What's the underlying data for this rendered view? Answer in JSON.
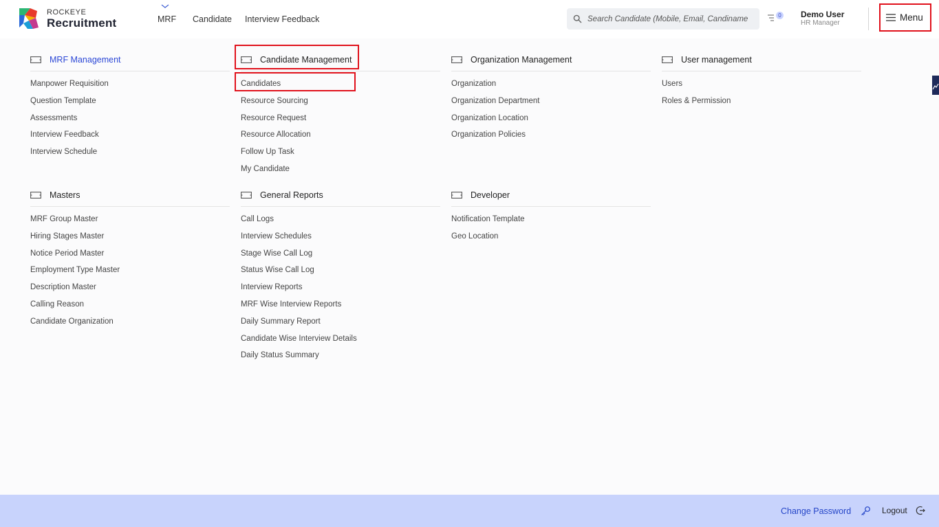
{
  "header": {
    "brand_top": "ROCKEYE",
    "brand_main": "Recruitment",
    "nav": [
      "MRF",
      "Candidate",
      "Interview Feedback"
    ],
    "search_placeholder": "Search Candidate (Mobile, Email, Candiname",
    "notification_count": "0",
    "user_name": "Demo User",
    "user_role": "HR Manager",
    "menu_label": "Menu"
  },
  "sections": [
    {
      "title": "MRF Management",
      "items": [
        "Manpower Requisition",
        "Question Template",
        "Assessments",
        "Interview Feedback",
        "Interview Schedule"
      ]
    },
    {
      "title": "Candidate Management",
      "items": [
        "Candidates",
        "Resource Sourcing",
        "Resource Request",
        "Resource Allocation",
        "Follow Up Task",
        "My Candidate"
      ]
    },
    {
      "title": "Organization Management",
      "items": [
        "Organization",
        "Organization Department",
        "Organization Location",
        "Organization Policies"
      ]
    },
    {
      "title": "User management",
      "items": [
        "Users",
        "Roles & Permission"
      ]
    },
    {
      "title": "Masters",
      "items": [
        "MRF Group Master",
        "Hiring Stages Master",
        "Notice Period Master",
        "Employment Type Master",
        "Description Master",
        "Calling Reason",
        "Candidate Organization"
      ]
    },
    {
      "title": "General Reports",
      "items": [
        "Call Logs",
        "Interview Schedules",
        "Stage Wise Call Log",
        "Status Wise Call Log",
        "Interview Reports",
        "MRF Wise Interview Reports",
        "Daily Summary Report",
        "Candidate Wise Interview Details",
        "Daily Status Summary"
      ]
    },
    {
      "title": "Developer",
      "items": [
        "Notification Template",
        "Geo Location"
      ]
    }
  ],
  "footer": {
    "change_password": "Change Password",
    "logout": "Logout"
  },
  "colors": {
    "accent": "#2b47d6",
    "highlight": "#e0101a",
    "footer_bg": "#c8d3fc"
  }
}
